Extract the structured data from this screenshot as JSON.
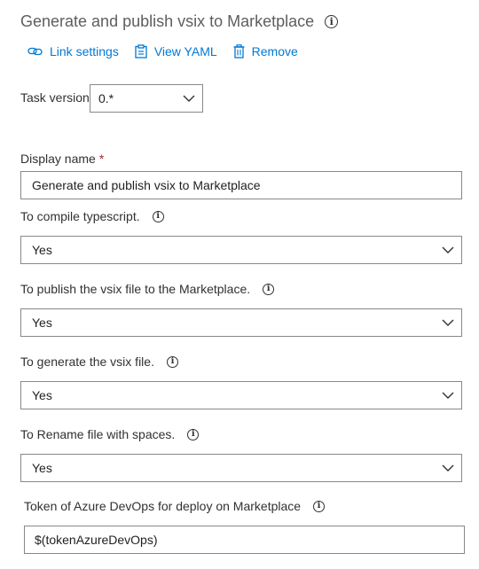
{
  "header": {
    "title": "Generate and publish vsix to Marketplace",
    "info_icon": "info-icon"
  },
  "actions": {
    "link_settings": "Link settings",
    "view_yaml": "View YAML",
    "remove": "Remove"
  },
  "task_version": {
    "label": "Task version",
    "value": "0.*"
  },
  "display_name": {
    "label": "Display name",
    "required_mark": "*",
    "value": "Generate and publish vsix to Marketplace"
  },
  "fields": [
    {
      "label": "To compile typescript.",
      "value": "Yes"
    },
    {
      "label": "To publish the vsix file to the Marketplace.",
      "value": "Yes"
    },
    {
      "label": "To generate the vsix file.",
      "value": "Yes"
    },
    {
      "label": "To Rename file with spaces.",
      "value": "Yes"
    }
  ],
  "token": {
    "label": "Token of Azure DevOps for deploy on Marketplace",
    "value": "$(tokenAzureDevOps)"
  },
  "colors": {
    "link": "#0078d4",
    "title": "#605e5c",
    "border": "#8a8886",
    "required": "#a4262c"
  }
}
